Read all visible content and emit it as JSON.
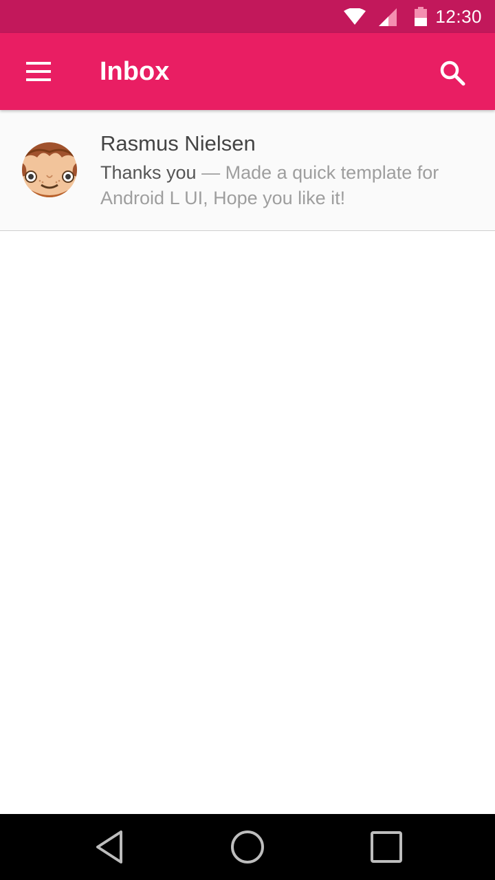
{
  "status_bar": {
    "time": "12:30",
    "icons": [
      "wifi-icon",
      "cell-signal-icon",
      "battery-icon"
    ],
    "color": "#c2185b"
  },
  "app_bar": {
    "title": "Inbox",
    "menu_icon": "hamburger-menu-icon",
    "search_icon": "search-icon",
    "color": "#e91e63"
  },
  "messages": [
    {
      "sender": "Rasmus Nielsen",
      "subject": "Thanks you",
      "separator": " — ",
      "snippet": "Made a quick template for Android L UI, Hope you like it!",
      "avatar_icon": "cartoon-face-avatar"
    }
  ],
  "nav_bar": {
    "icons": [
      "back-icon",
      "home-icon",
      "recents-icon"
    ]
  }
}
